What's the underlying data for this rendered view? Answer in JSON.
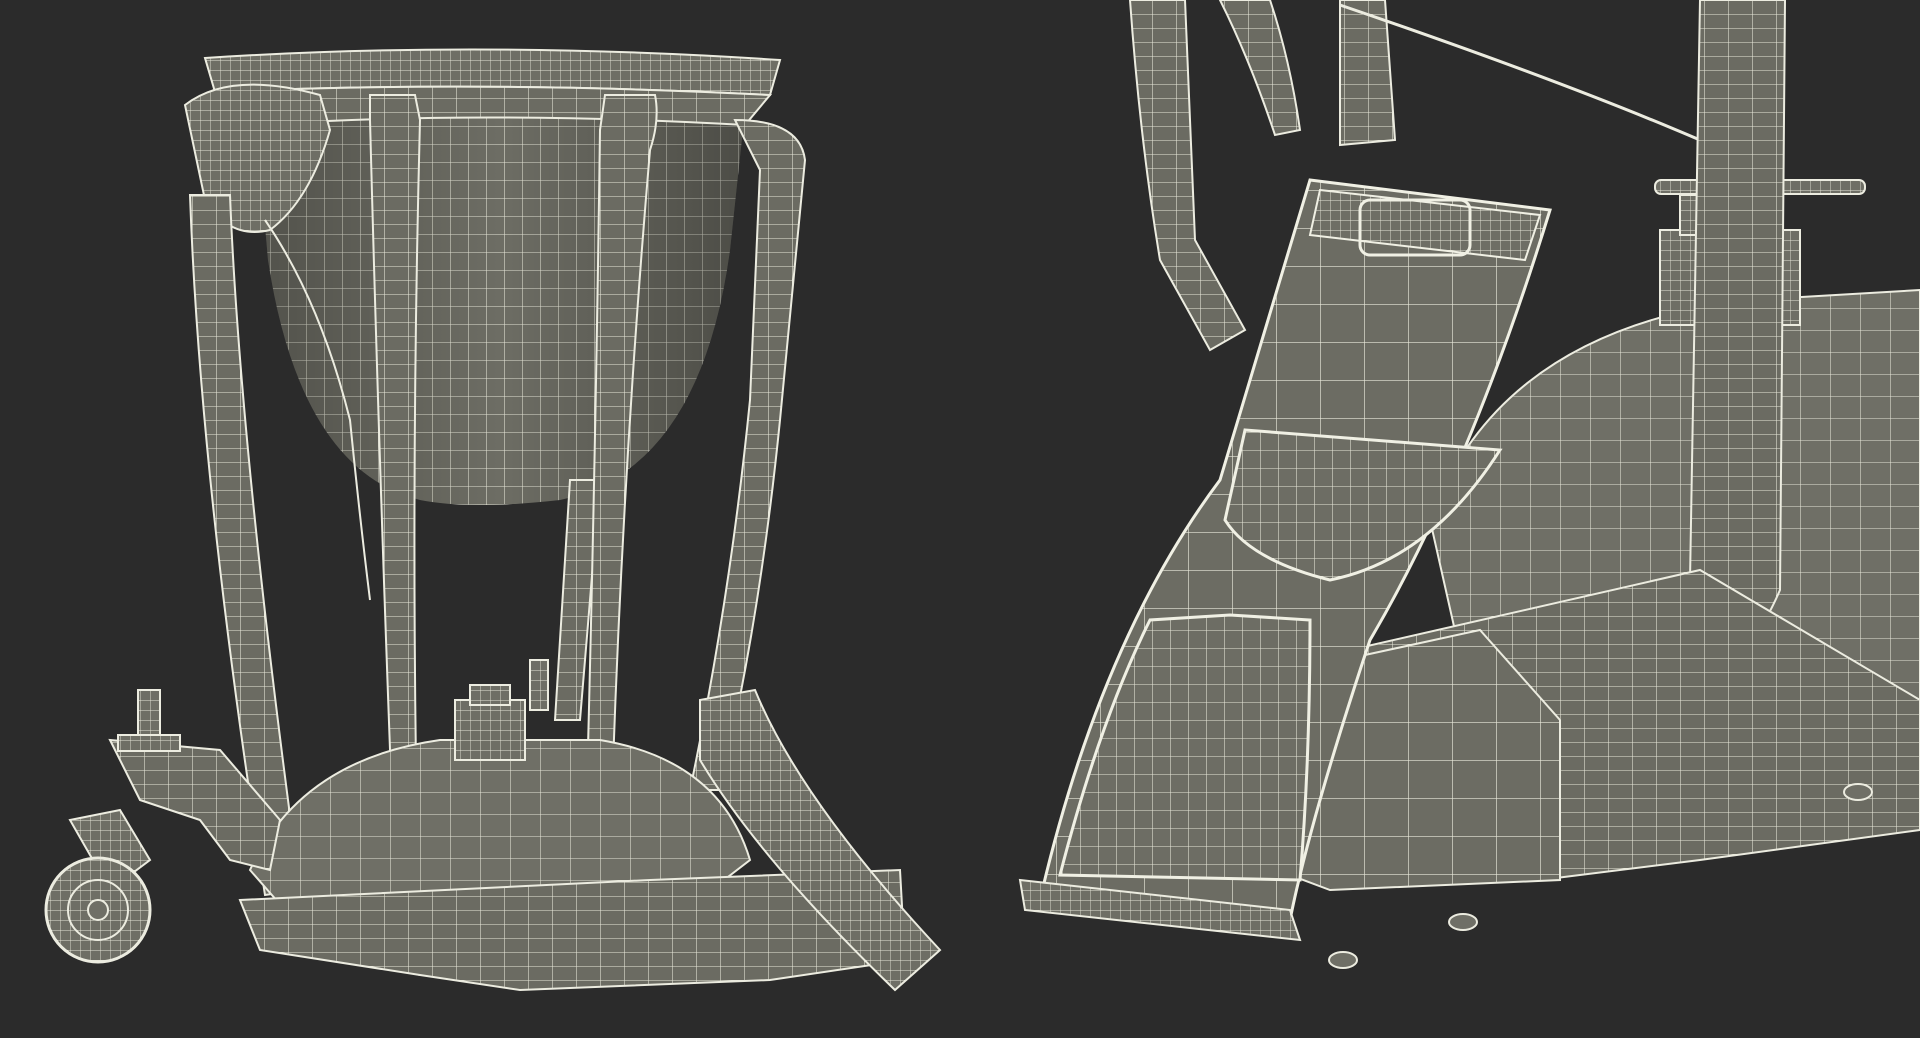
{
  "scene": {
    "background_color": "#2b2b2b",
    "mesh_surface_color": "#6f6f66",
    "mesh_dark_color": "#5a5a53",
    "wireframe_color": "#ebebdf",
    "panels": [
      {
        "subject": "timpani-drum-full-view-wireframe"
      },
      {
        "subject": "timpani-pedal-closeup-wireframe"
      }
    ]
  }
}
